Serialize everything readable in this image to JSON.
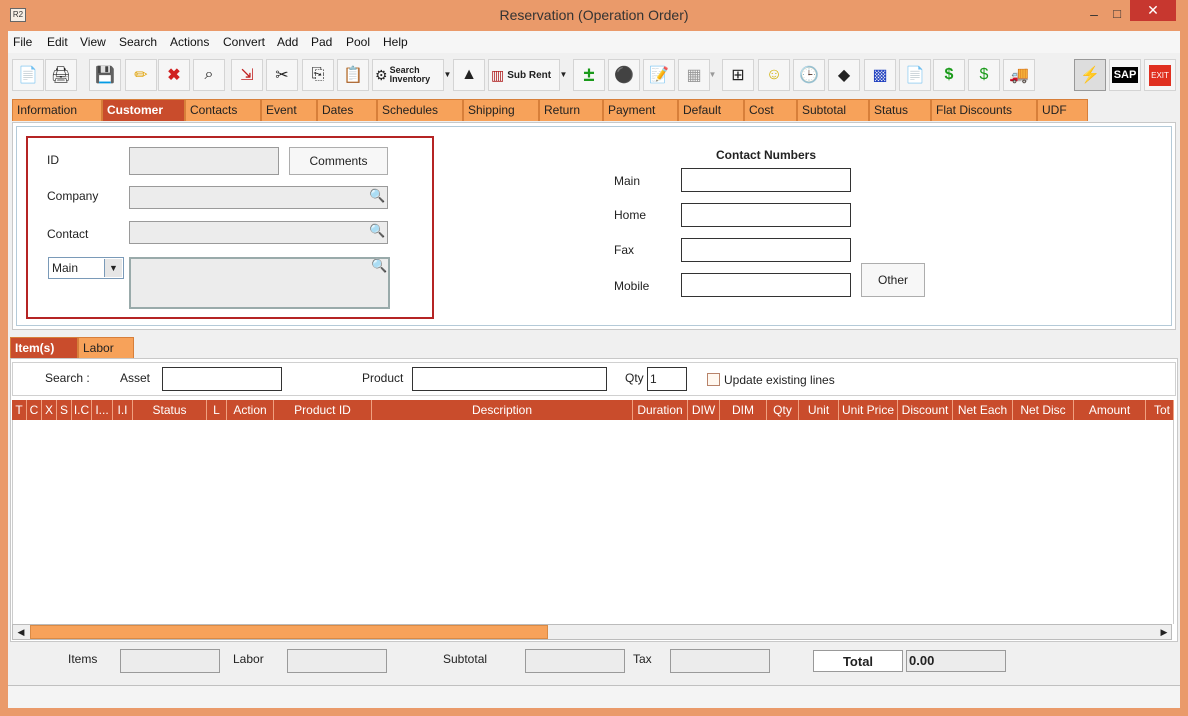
{
  "window": {
    "title": "Reservation (Operation Order)",
    "app_icon": "R2",
    "minimize": "–",
    "maximize": "□",
    "close": "✕"
  },
  "menu": [
    "File",
    "Edit",
    "View",
    "Search",
    "Actions",
    "Convert",
    "Add",
    "Pad",
    "Pool",
    "Help"
  ],
  "toolbar": {
    "search_inventory_line1": "Search",
    "search_inventory_line2": "Inventory",
    "sub_rent": "Sub Rent",
    "sap": "SAP",
    "exit": "EXIT"
  },
  "tabs": [
    "Information",
    "Customer",
    "Contacts",
    "Event",
    "Dates",
    "Schedules",
    "Shipping",
    "Return",
    "Payment",
    "Default",
    "Cost",
    "Subtotal",
    "Status",
    "Flat Discounts",
    "UDF"
  ],
  "active_tab": "Customer",
  "customer": {
    "id_label": "ID",
    "id_value": "",
    "comments_button": "Comments",
    "company_label": "Company",
    "company_value": "",
    "contact_label": "Contact",
    "contact_value": "",
    "address_type": "Main",
    "address_value": ""
  },
  "contact_numbers": {
    "heading": "Contact Numbers",
    "main_label": "Main",
    "home_label": "Home",
    "fax_label": "Fax",
    "mobile_label": "Mobile",
    "other_button": "Other"
  },
  "sub_tabs": [
    "Item(s)",
    "Labor"
  ],
  "item_search": {
    "search_label": "Search :",
    "asset_label": "Asset",
    "product_label": "Product",
    "qty_label": "Qty",
    "qty_value": "1",
    "update_existing": "Update existing lines"
  },
  "grid_columns": [
    "T",
    "C",
    "X",
    "S",
    "I.C",
    "I...",
    "I.I",
    "Status",
    "L",
    "Action",
    "Product ID",
    "Description",
    "Duration",
    "DIW",
    "DIM",
    "Qty",
    "Unit",
    "Unit Price",
    "Discount",
    "Net Each",
    "Net Disc",
    "Amount",
    "Tot"
  ],
  "footer": {
    "items_label": "Items",
    "labor_label": "Labor",
    "subtotal_label": "Subtotal",
    "tax_label": "Tax",
    "total_label": "Total",
    "total_value": "0.00"
  },
  "colors": {
    "accent": "#c94c2c",
    "tab": "#f7a25a",
    "frame": "#ea9a6a",
    "highlight_border": "#b52424"
  }
}
